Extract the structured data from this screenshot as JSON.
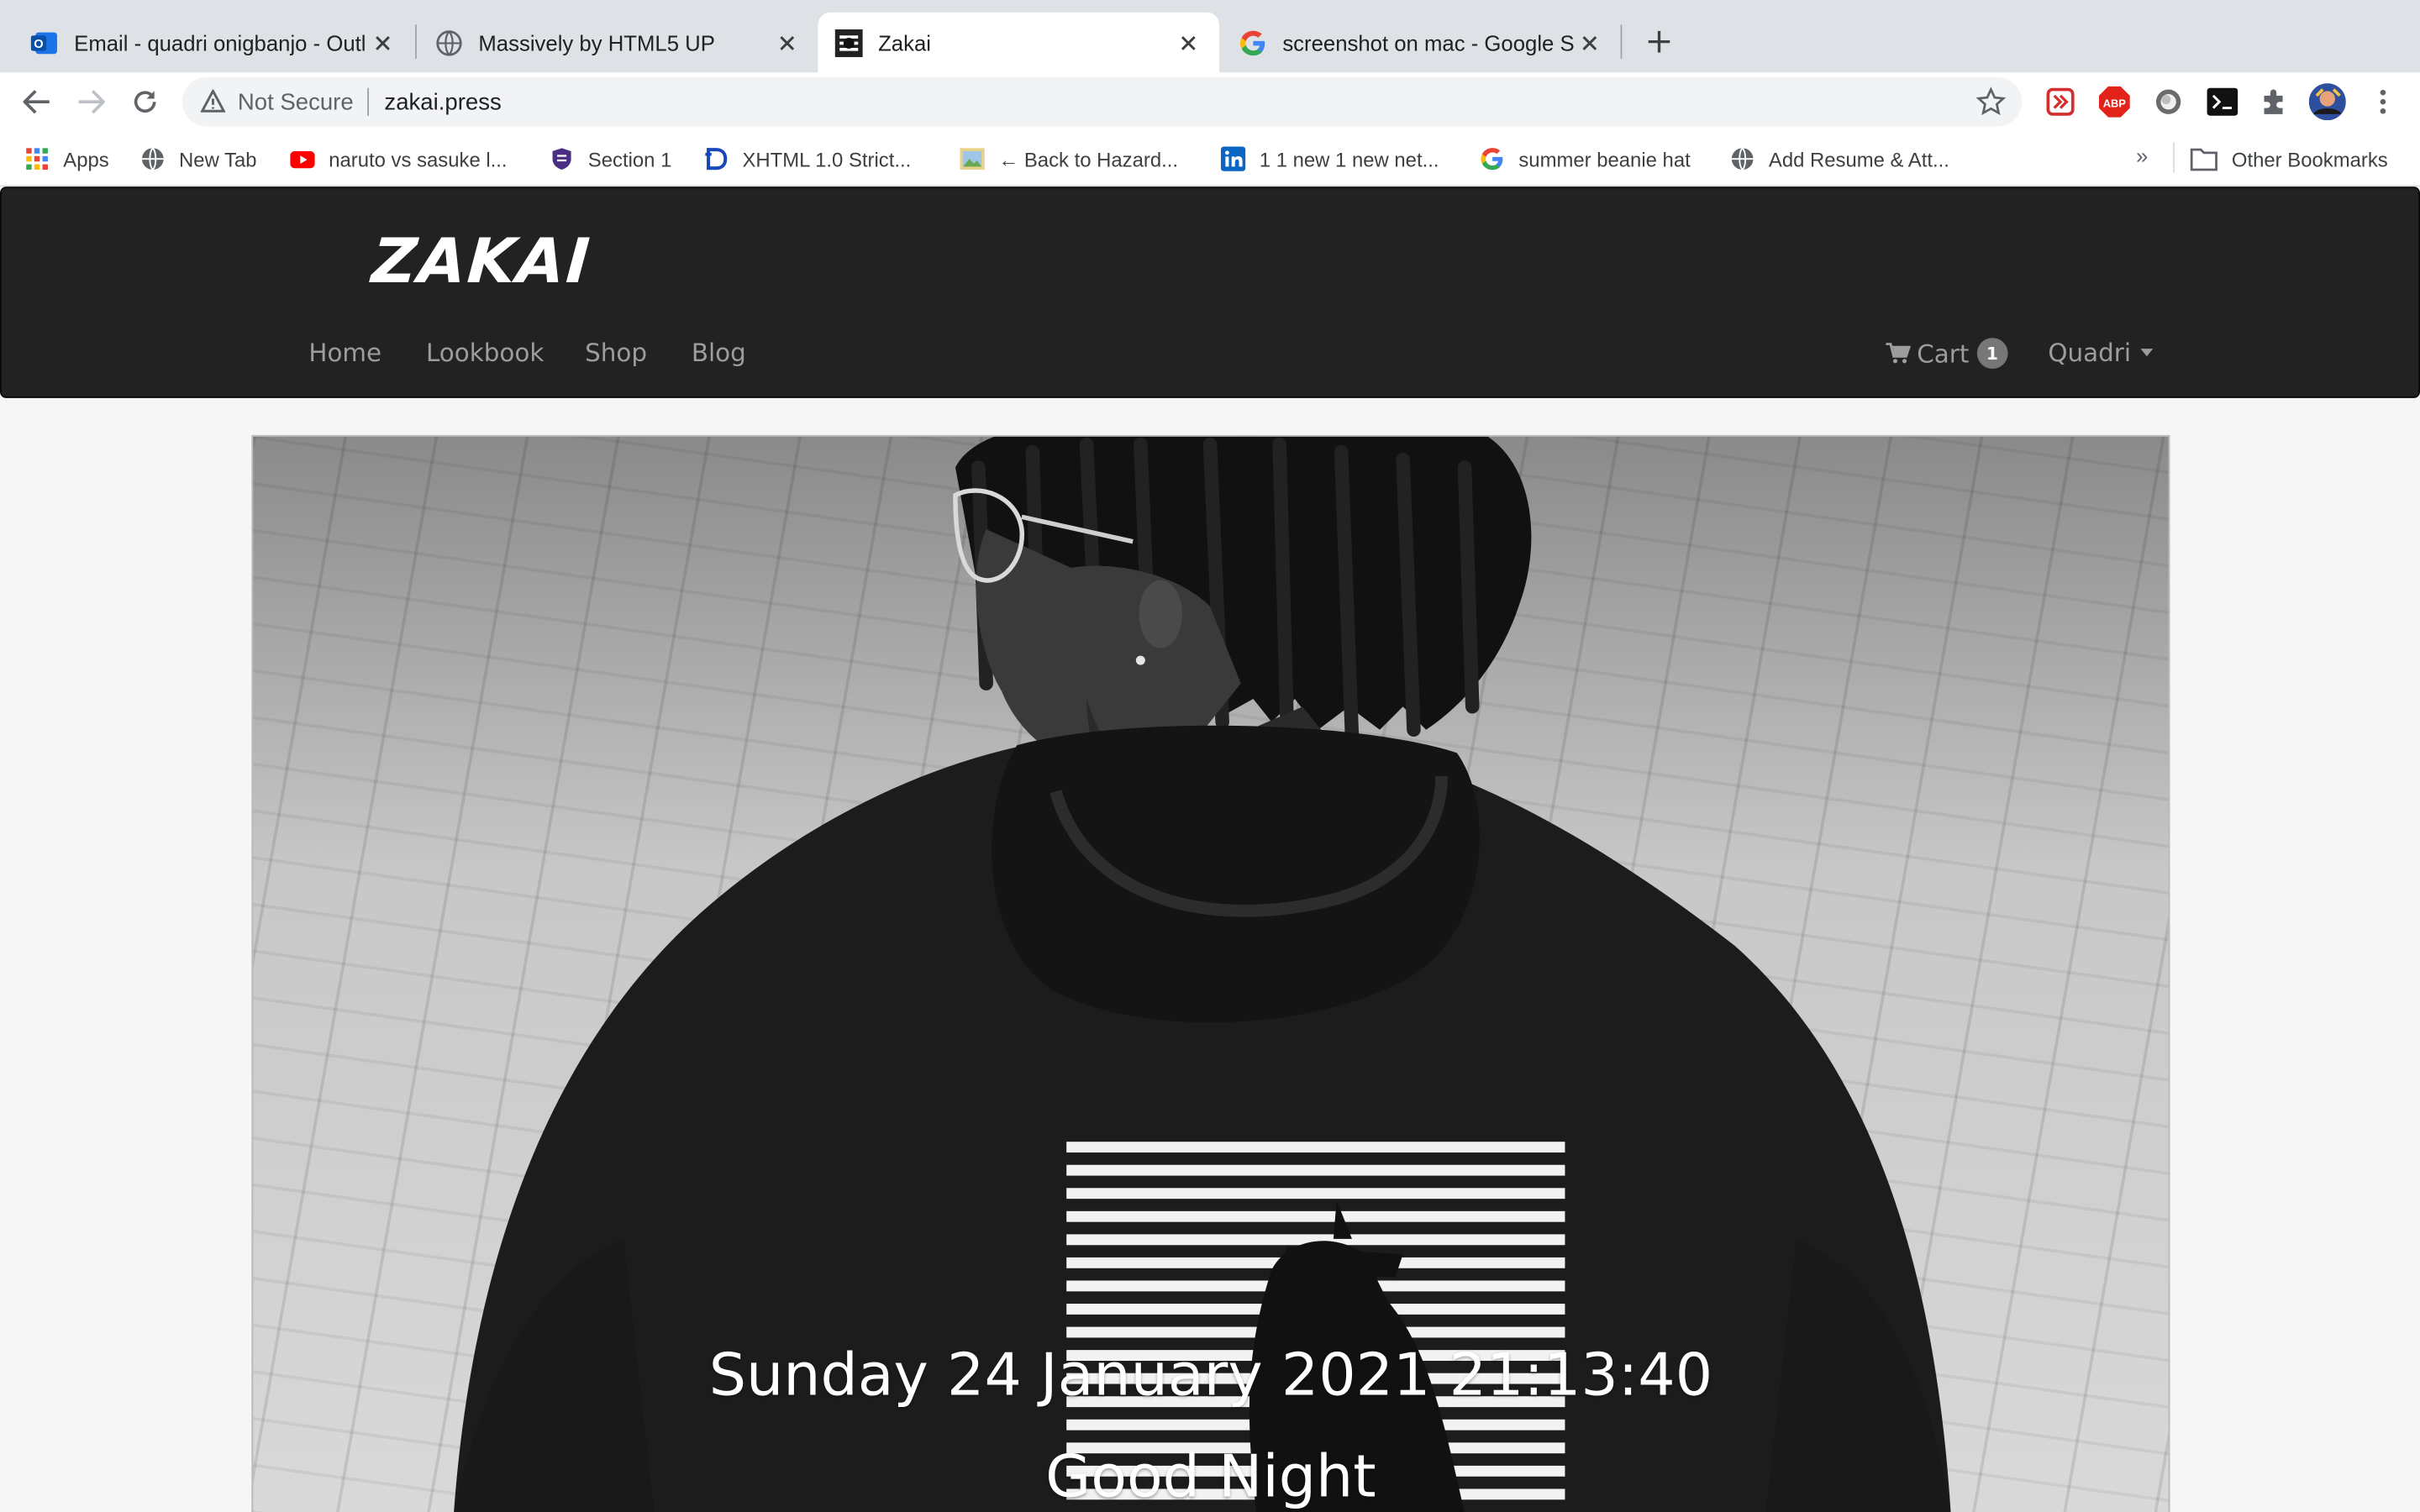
{
  "browser": {
    "tabs": [
      {
        "title": "Email - quadri onigbanjo - Outl",
        "icon": "outlook-icon",
        "active": false
      },
      {
        "title": "Massively by HTML5 UP",
        "icon": "globe-icon",
        "active": false
      },
      {
        "title": "Zakai",
        "icon": "zakai-favicon",
        "active": true
      },
      {
        "title": "screenshot on mac - Google Se",
        "icon": "google-icon",
        "active": false
      }
    ],
    "omnibox": {
      "security_label": "Not Secure",
      "url": "zakai.press"
    },
    "bookmarks": [
      {
        "label": "Apps",
        "icon": "apps-grid-icon"
      },
      {
        "label": "New Tab",
        "icon": "globe-icon"
      },
      {
        "label": "naruto vs sasuke l...",
        "icon": "youtube-icon"
      },
      {
        "label": "Section 1",
        "icon": "shield-icon"
      },
      {
        "label": "XHTML 1.0 Strict...",
        "icon": "d-logo-icon"
      },
      {
        "label": "← Back to Hazard...",
        "icon": "image-icon"
      },
      {
        "label": "1 1 new 1 new net...",
        "icon": "linkedin-icon"
      },
      {
        "label": "summer beanie hat",
        "icon": "google-icon"
      },
      {
        "label": "Add Resume & Att...",
        "icon": "globe-icon"
      }
    ],
    "bookmarks_overflow": "»",
    "other_bookmarks": "Other Bookmarks"
  },
  "site": {
    "logo": "ZAKAI",
    "nav": [
      "Home",
      "Lookbook",
      "Shop",
      "Blog"
    ],
    "cart_label": "Cart",
    "cart_count": "1",
    "user": "Quadri"
  },
  "hero": {
    "datetime": "Sunday 24 January 2021 21:13:40",
    "greeting": "Good Night"
  }
}
